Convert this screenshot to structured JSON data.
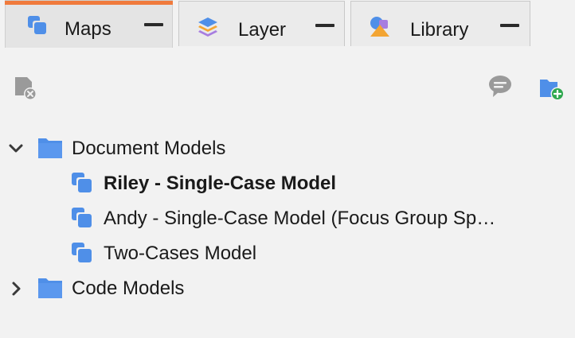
{
  "tabs": [
    {
      "label": "Maps",
      "icon": "maps-icon",
      "active": true
    },
    {
      "label": "Layer",
      "icon": "layers-icon",
      "active": false
    },
    {
      "label": "Library",
      "icon": "library-shapes-icon",
      "active": false
    }
  ],
  "toolbar": {
    "left_icon": "remove-map-icon",
    "comment_icon": "comment-icon",
    "new_folder_icon": "new-folder-icon"
  },
  "tree": {
    "groups": [
      {
        "label": "Document Models",
        "expanded": true,
        "items": [
          {
            "label": "Riley - Single-Case Model",
            "selected": true
          },
          {
            "label": "Andy - Single-Case Model (Focus Group Sp…",
            "selected": false
          },
          {
            "label": "Two-Cases Model",
            "selected": false
          }
        ]
      },
      {
        "label": "Code Models",
        "expanded": false,
        "items": []
      }
    ]
  },
  "colors": {
    "accent": "#f07a3c",
    "folder_blue": "#4f8fe8",
    "icon_gray": "#9a9a9a",
    "add_green": "#2fa84f"
  }
}
